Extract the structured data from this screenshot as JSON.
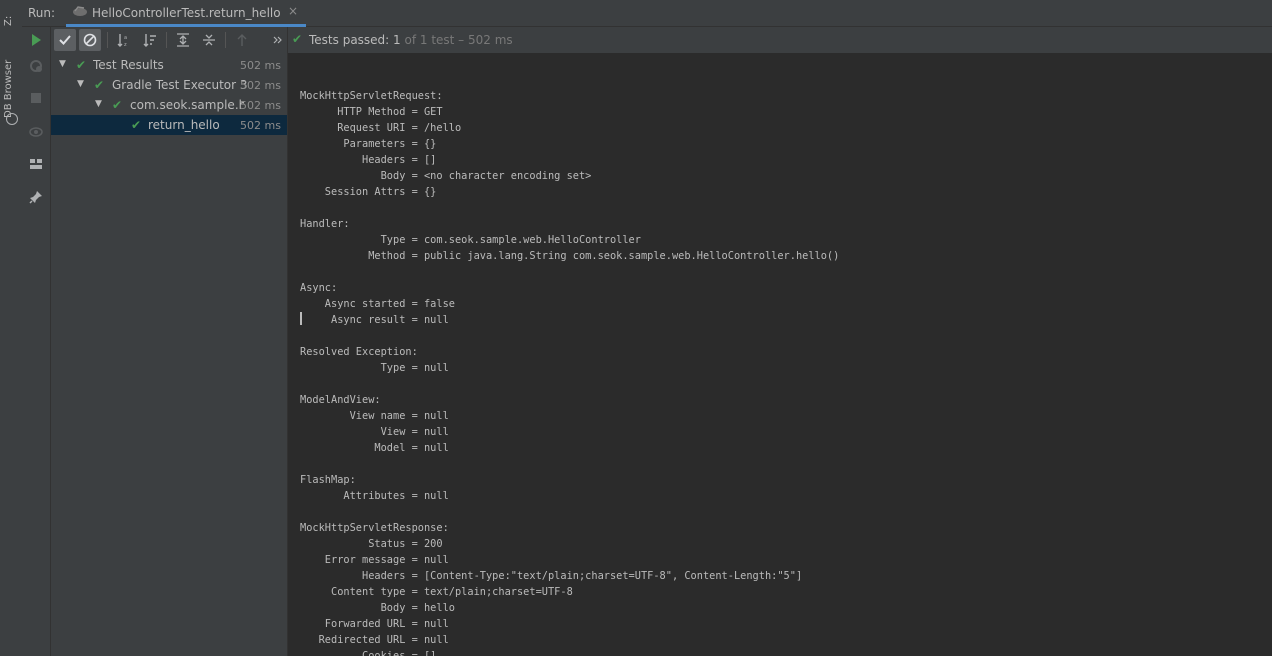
{
  "side_strip": {
    "top_label": "Z:",
    "db_browser": "DB Browser"
  },
  "run_header": {
    "label": "Run:",
    "tab_title": "HelloControllerTest.return_hello",
    "close": "×"
  },
  "status": {
    "main": "Tests passed: ",
    "count": "1",
    "rest": " of 1 test – 502 ms"
  },
  "tree": [
    {
      "label": "Test Results",
      "time": "502 ms"
    },
    {
      "label": "Gradle Test Executor 3",
      "time": "502 ms"
    },
    {
      "label": "com.seok.sample.hell",
      "time": "502 ms"
    },
    {
      "label": "return_hello",
      "time": "502 ms"
    }
  ],
  "console_lines": [
    "",
    "MockHttpServletRequest:",
    "      HTTP Method = GET",
    "      Request URI = /hello",
    "       Parameters = {}",
    "          Headers = []",
    "             Body = <no character encoding set>",
    "    Session Attrs = {}",
    "",
    "Handler:",
    "             Type = com.seok.sample.web.HelloController",
    "           Method = public java.lang.String com.seok.sample.web.HelloController.hello()",
    "",
    "Async:",
    "    Async started = false",
    "     Async result = null",
    "",
    "Resolved Exception:",
    "             Type = null",
    "",
    "ModelAndView:",
    "        View name = null",
    "             View = null",
    "            Model = null",
    "",
    "FlashMap:",
    "       Attributes = null",
    "",
    "MockHttpServletResponse:",
    "           Status = 200",
    "    Error message = null",
    "          Headers = [Content-Type:\"text/plain;charset=UTF-8\", Content-Length:\"5\"]",
    "     Content type = text/plain;charset=UTF-8",
    "             Body = hello",
    "    Forwarded URL = null",
    "   Redirected URL = null",
    "          Cookies = []"
  ],
  "colors": {
    "pass": "#499c54",
    "selection": "#0d293e",
    "tab_underline": "#4a88c7"
  }
}
